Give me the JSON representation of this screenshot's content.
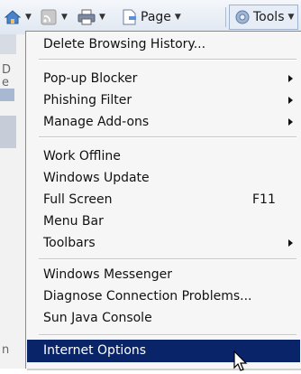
{
  "toolbar": {
    "page_label": "Page",
    "tools_label": "Tools"
  },
  "left_strip": {
    "chars": [
      "D",
      "e",
      "n"
    ]
  },
  "menu": {
    "groups": [
      {
        "items": [
          {
            "label": "Delete Browsing History..."
          }
        ]
      },
      {
        "items": [
          {
            "label": "Pop-up Blocker",
            "submenu": true
          },
          {
            "label": "Phishing Filter",
            "submenu": true
          },
          {
            "label": "Manage Add-ons",
            "submenu": true
          }
        ]
      },
      {
        "items": [
          {
            "label": "Work Offline"
          },
          {
            "label": "Windows Update"
          },
          {
            "label": "Full Screen",
            "shortcut": "F11"
          },
          {
            "label": "Menu Bar"
          },
          {
            "label": "Toolbars",
            "submenu": true
          }
        ]
      },
      {
        "items": [
          {
            "label": "Windows Messenger"
          },
          {
            "label": "Diagnose Connection Problems..."
          },
          {
            "label": "Sun Java Console"
          }
        ]
      },
      {
        "items": [
          {
            "label": "Internet Options",
            "highlighted": true
          }
        ]
      }
    ]
  },
  "colors": {
    "highlight": "#0a246a",
    "menu_bg": "#f6f6f6"
  }
}
